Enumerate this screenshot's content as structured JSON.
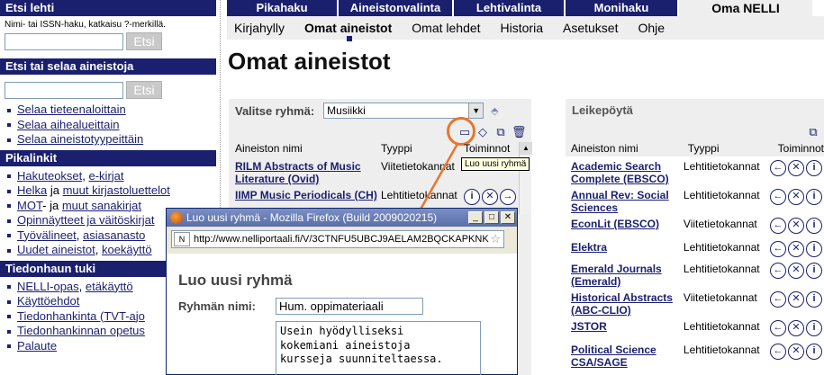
{
  "left": {
    "etsi_lehti": {
      "title": "Etsi lehti",
      "hint": "Nimi- tai ISSN-haku, katkaisu ?-merkillä.",
      "button": "Etsi"
    },
    "etsi_aineistoja": {
      "title": "Etsi tai selaa aineistoja",
      "button": "Etsi",
      "links": [
        "Selaa tieteenaloittain",
        "Selaa aihealueittain",
        "Selaa aineistotyypeittäin"
      ]
    },
    "pikalinkit": {
      "title": "Pikalinkit",
      "items": [
        [
          {
            "t": "Hakuteokset",
            "l": true
          },
          {
            "t": ", ",
            "l": false
          },
          {
            "t": "e-kirjat",
            "l": true
          }
        ],
        [
          {
            "t": "Helka",
            "l": true
          },
          {
            "t": " ja ",
            "l": false
          },
          {
            "t": "muut kirjastoluettelot",
            "l": true
          }
        ],
        [
          {
            "t": "MOT",
            "l": true
          },
          {
            "t": "- ja ",
            "l": false
          },
          {
            "t": "muut sanakirjat",
            "l": true
          }
        ],
        [
          {
            "t": "Opinnäytteet ja väitöskirjat",
            "l": true
          }
        ],
        [
          {
            "t": "Työvälineet",
            "l": true
          },
          {
            "t": ", ",
            "l": false
          },
          {
            "t": "asiasanasto",
            "l": true
          }
        ],
        [
          {
            "t": "Uudet aineistot",
            "l": true
          },
          {
            "t": ", ",
            "l": false
          },
          {
            "t": "koekäyttö",
            "l": true
          }
        ]
      ]
    },
    "tiedonhaun_tuki": {
      "title": "Tiedonhaun tuki",
      "items": [
        [
          {
            "t": "NELLI-opas",
            "l": true
          },
          {
            "t": ", ",
            "l": false
          },
          {
            "t": "etäkäyttö",
            "l": true
          }
        ],
        [
          {
            "t": "Käyttöehdot",
            "l": true
          }
        ],
        [
          {
            "t": "Tiedonhankinta (TVT-ajo",
            "l": true
          }
        ],
        [
          {
            "t": "Tiedonhankinnan opetus",
            "l": true
          }
        ],
        [
          {
            "t": "Palaute",
            "l": true
          }
        ]
      ]
    }
  },
  "nav": {
    "tabs": [
      "Pikahaku",
      "Aineistonvalinta",
      "Lehtivalinta",
      "Monihaku",
      "Oma NELLI"
    ],
    "subtabs": [
      "Kirjahylly",
      "Omat aineistot",
      "Omat lehdet",
      "Historia",
      "Asetukset",
      "Ohje"
    ]
  },
  "page_title": "Omat aineistot",
  "group": {
    "label": "Valitse ryhmä:",
    "selected": "Musiikki",
    "headers": [
      "Aineiston nimi",
      "Tyyppi",
      "Toiminnot"
    ],
    "rows": [
      {
        "name": "RILM Abstracts of Music Literature (Ovid)",
        "type": "Viitetietokannat"
      },
      {
        "name": "IIMP Music Periodicals (CH)",
        "type": "Lehtitietokannat"
      }
    ],
    "tooltip": "Luo uusi ryhmä"
  },
  "clipboard": {
    "title": "Leikepöytä",
    "headers": [
      "Aineiston nimi",
      "Tyyppi",
      "Toiminnot"
    ],
    "rows": [
      {
        "name": "Academic Search Complete (EBSCO)",
        "type": "Lehtitietokannat"
      },
      {
        "name": "Annual Rev: Social Sciences",
        "type": "Lehtitietokannat"
      },
      {
        "name": "EconLit (EBSCO)",
        "type": "Viitetietokannat"
      },
      {
        "name": "Elektra",
        "type": "Lehtitietokannat"
      },
      {
        "name": "Emerald Journals (Emerald)",
        "type": "Lehtitietokannat"
      },
      {
        "name": "Historical Abstracts (ABC-CLIO)",
        "type": "Viitetietokannat"
      },
      {
        "name": "JSTOR",
        "type": "Lehtitietokannat"
      },
      {
        "name": "Political Science CSA/SAGE",
        "type": "Lehtitietokannat"
      }
    ]
  },
  "popup": {
    "title": "Luo uusi ryhmä - Mozilla Firefox (Build 2009020215)",
    "url": "http://www.nelliportaali.fi/V/3CTNFU5UBCJ9AELAM2BQCKAPKNK",
    "heading": "Luo uusi ryhmä",
    "name_label": "Ryhmän nimi:",
    "name_value": "Hum. oppimateriaali",
    "desc_value": "Usein hyödylliseksi\nkokemiani aineistoja\nkursseja suunniteltaessa."
  },
  "colors": {
    "nav_blue": "#1a1f6e",
    "highlight": "#e8762b"
  }
}
